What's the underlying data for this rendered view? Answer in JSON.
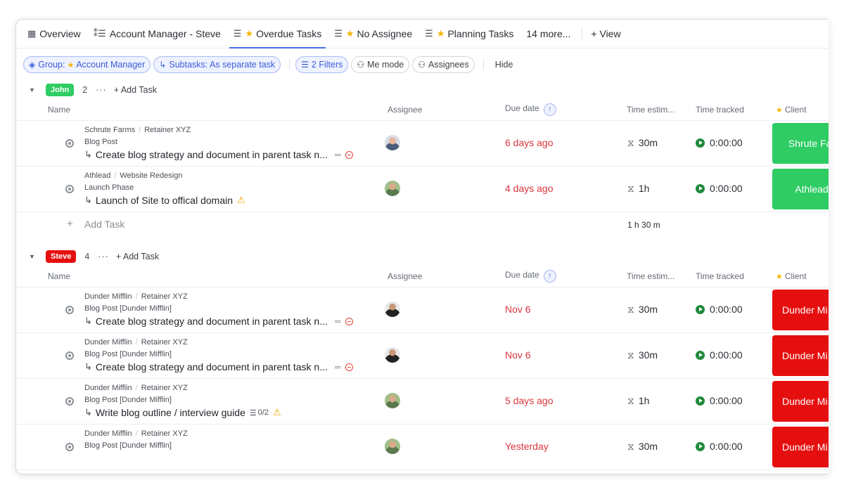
{
  "view_tabs": [
    {
      "icon": "board-icon",
      "label": "Overview",
      "starred": false
    },
    {
      "icon": "activity-list-icon",
      "label": "Account Manager - Steve",
      "starred": false
    },
    {
      "icon": "list-icon",
      "label": "Overdue Tasks",
      "starred": true,
      "active": true
    },
    {
      "icon": "list-icon",
      "label": "No Assignee",
      "starred": true
    },
    {
      "icon": "list-icon",
      "label": "Planning Tasks",
      "starred": true
    },
    {
      "label": "14 more..."
    }
  ],
  "add_view_label": "+ View",
  "filters": {
    "group_prefix": "Group:",
    "group_value": "Account Manager",
    "subtasks_label": "Subtasks: As separate task",
    "filters_label": "2 Filters",
    "me_mode_label": "Me mode",
    "assignees_label": "Assignees",
    "hide_label": "Hide"
  },
  "columns": {
    "name": "Name",
    "assignee": "Assignee",
    "due_date": "Due date",
    "time_estimate": "Time estim...",
    "time_tracked": "Time tracked",
    "client": "Client"
  },
  "groups": [
    {
      "badge": "John",
      "badge_color": "#2ecc63",
      "count": "2",
      "dots": "···",
      "add_task_label": "+ Add Task",
      "rows": [
        {
          "crumb1": "Schrute Farms",
          "crumb2": "Retainer XYZ",
          "parent": "Blog Post",
          "title": "Create blog strategy and document in parent task n...",
          "extras": "lines-minus",
          "avatar": "av-a",
          "due": "6 days ago",
          "estimate": "30m",
          "tracked": "0:00:00",
          "client": "Shrute Far",
          "client_color": "green"
        },
        {
          "crumb1": "Athlead",
          "crumb2": "Website Redesign",
          "parent": "Launch Phase",
          "title": "Launch of Site to offical domain",
          "extras": "warn",
          "avatar": "av-b",
          "due": "4 days ago",
          "estimate": "1h",
          "tracked": "0:00:00",
          "client": "Athlead",
          "client_color": "green"
        }
      ],
      "footer": {
        "add_label": "Add Task",
        "sum": "1 h 30 m"
      }
    },
    {
      "badge": "Steve",
      "badge_color": "#e60f0f",
      "count": "4",
      "dots": "···",
      "add_task_label": "+ Add Task",
      "rows": [
        {
          "crumb1": "Dunder Mifflin",
          "crumb2": "Retainer XYZ",
          "parent": "Blog Post [Dunder Mifflin]",
          "title": "Create blog strategy and document in parent task n...",
          "extras": "lines-minus",
          "avatar": "av-c",
          "due": "Nov 6",
          "estimate": "30m",
          "tracked": "0:00:00",
          "client": "Dunder Mi",
          "client_color": "red"
        },
        {
          "crumb1": "Dunder Mifflin",
          "crumb2": "Retainer XYZ",
          "parent": "Blog Post [Dunder Mifflin]",
          "title": "Create blog strategy and document in parent task n...",
          "extras": "lines-minus",
          "avatar": "av-c",
          "due": "Nov 6",
          "estimate": "30m",
          "tracked": "0:00:00",
          "client": "Dunder Mi",
          "client_color": "red"
        },
        {
          "crumb1": "Dunder Mifflin",
          "crumb2": "Retainer XYZ",
          "parent": "Blog Post [Dunder Mifflin]",
          "title": "Write blog outline / interview guide",
          "extras": "checklist-warn",
          "checklist": "0/2",
          "avatar": "av-b",
          "due": "5 days ago",
          "estimate": "1h",
          "tracked": "0:00:00",
          "client": "Dunder Mi",
          "client_color": "red"
        },
        {
          "crumb1": "Dunder Mifflin",
          "crumb2": "Retainer XYZ",
          "parent": "Blog Post [Dunder Mifflin]",
          "title": "",
          "extras": "",
          "avatar": "av-b",
          "due": "Yesterday",
          "estimate": "30m",
          "tracked": "0:00:00",
          "client": "Dunder Mi",
          "client_color": "red"
        }
      ]
    }
  ]
}
